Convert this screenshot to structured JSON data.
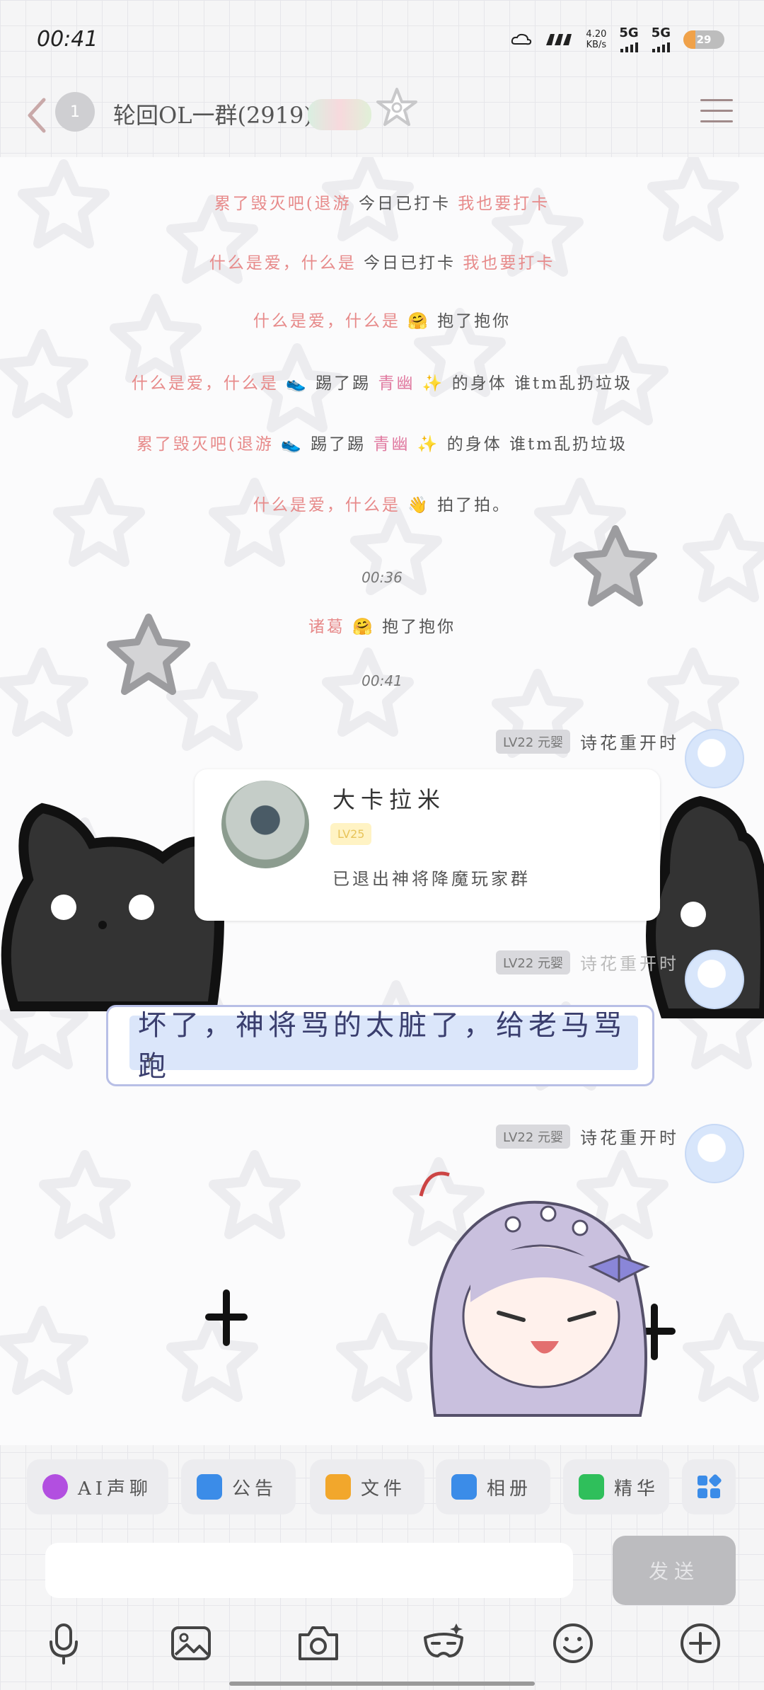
{
  "status_bar": {
    "time": "00:41",
    "net_speed_value": "4.20",
    "net_speed_unit": "KB/s",
    "signal1": "5G",
    "signal2": "5G",
    "battery": "29",
    "battery_level": 0.29
  },
  "header": {
    "unread_badge": "1",
    "title": "轮回OL一群(2919)"
  },
  "system_messages": [
    {
      "name": "累了毁灭吧(退游",
      "action": "今日已打卡",
      "tail": "我也要打卡"
    },
    {
      "name": "什么是爱，什么是",
      "action": "今日已打卡",
      "tail": "我也要打卡"
    },
    {
      "name": "什么是爱，什么是",
      "action": "抱了抱你",
      "tail": ""
    },
    {
      "name": "什么是爱，什么是",
      "action": "踢了踢",
      "highlight": "青幽",
      "tail": "的身体 谁tm乱扔垃圾"
    },
    {
      "name": "累了毁灭吧(退游",
      "action": "踢了踢",
      "highlight": "青幽",
      "tail": "的身体 谁tm乱扔垃圾"
    },
    {
      "name": "什么是爱，什么是",
      "action": "拍了拍。",
      "tail": ""
    }
  ],
  "timestamps": [
    "00:36",
    "00:41"
  ],
  "late_message": {
    "name": "诸葛",
    "action": "抱了抱你"
  },
  "messages": [
    {
      "level": "LV22 元婴",
      "sender": "诗花重开时",
      "card": {
        "name": "大卡拉米",
        "level": "LV25",
        "desc": "已退出神将降魔玩家群"
      }
    },
    {
      "level": "LV22 元婴",
      "sender": "诗花重开时",
      "text": "坏了，神将骂的太脏了，给老马骂跑",
      "sub": "了"
    },
    {
      "level": "LV22 元婴",
      "sender": "诗花重开时"
    }
  ],
  "toolbar": [
    {
      "label": "AI声聊",
      "icon": "ai-voice-icon",
      "color": "#b24fe0"
    },
    {
      "label": "公告",
      "icon": "announcement-icon",
      "color": "#3b8ce8"
    },
    {
      "label": "文件",
      "icon": "folder-icon",
      "color": "#f2a72c"
    },
    {
      "label": "相册",
      "icon": "album-icon",
      "color": "#3b8ce8"
    },
    {
      "label": "精华",
      "icon": "highlight-icon",
      "color": "#2fbf5b"
    }
  ],
  "input": {
    "placeholder": "",
    "send_label": "发送"
  }
}
